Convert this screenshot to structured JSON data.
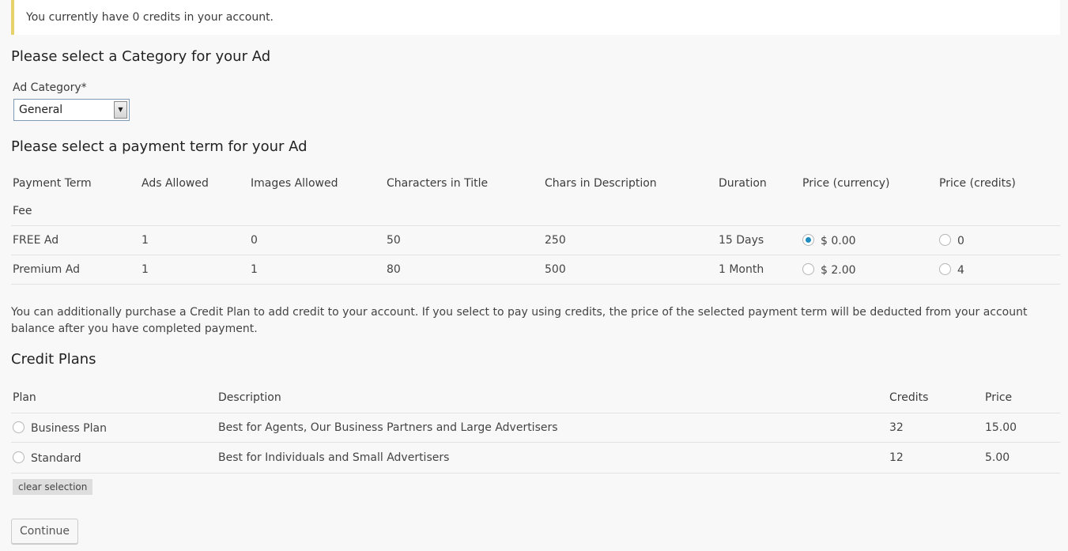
{
  "notice": "You currently have 0 credits in your account.",
  "category_section": {
    "heading": "Please select a Category for your Ad",
    "label": "Ad Category*",
    "selected": "General"
  },
  "term_section": {
    "heading": "Please select a payment term for your Ad",
    "columns": [
      "Payment Term",
      "Ads Allowed",
      "Images Allowed",
      "Characters in Title",
      "Chars in Description",
      "Duration",
      "Price (currency)",
      "Price (credits)"
    ],
    "fee_label": "Fee",
    "rows": [
      {
        "term": "FREE Ad",
        "ads": "1",
        "images": "0",
        "title_chars": "50",
        "desc_chars": "250",
        "duration": "15 Days",
        "price_currency": "$ 0.00",
        "price_credits": "0",
        "currency_selected": true,
        "credits_selected": false
      },
      {
        "term": "Premium Ad",
        "ads": "1",
        "images": "1",
        "title_chars": "80",
        "desc_chars": "500",
        "duration": "1 Month",
        "price_currency": "$ 2.00",
        "price_credits": "4",
        "currency_selected": false,
        "credits_selected": false
      }
    ]
  },
  "info_text": "You can additionally purchase a Credit Plan to add credit to your account. If you select to pay using credits, the price of the selected payment term will be deducted from your account balance after you have completed payment.",
  "plans_section": {
    "heading": "Credit Plans",
    "columns": [
      "Plan",
      "Description",
      "Credits",
      "Price"
    ],
    "rows": [
      {
        "plan": "Business Plan",
        "description": "Best for Agents, Our Business Partners and Large Advertisers",
        "credits": "32",
        "price": "15.00",
        "selected": false
      },
      {
        "plan": "Standard",
        "description": "Best for Individuals and Small Advertisers",
        "credits": "12",
        "price": "5.00",
        "selected": false
      }
    ]
  },
  "clear_label": "clear selection",
  "continue_label": "Continue",
  "colors": {
    "accent": "#1e8cbe",
    "notice_border": "#e8d36a",
    "background": "#f8f8f8"
  }
}
